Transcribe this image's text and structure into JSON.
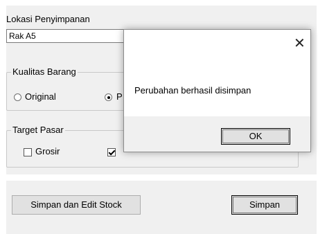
{
  "form": {
    "location_label": "Lokasi Penyimpanan",
    "location_value": "Rak A5",
    "quality": {
      "title": "Kualitas Barang",
      "original_label": "Original",
      "second_label": "P",
      "selected": "second"
    },
    "target": {
      "title": "Target Pasar",
      "grosir_label": "Grosir",
      "grosir_checked": false,
      "second_checked": true
    }
  },
  "footer": {
    "save_edit_label": "Simpan dan Edit Stock",
    "save_label": "Simpan"
  },
  "dialog": {
    "close_glyph": "✕",
    "message": "Perubahan berhasil disimpan",
    "ok_label": "OK"
  }
}
